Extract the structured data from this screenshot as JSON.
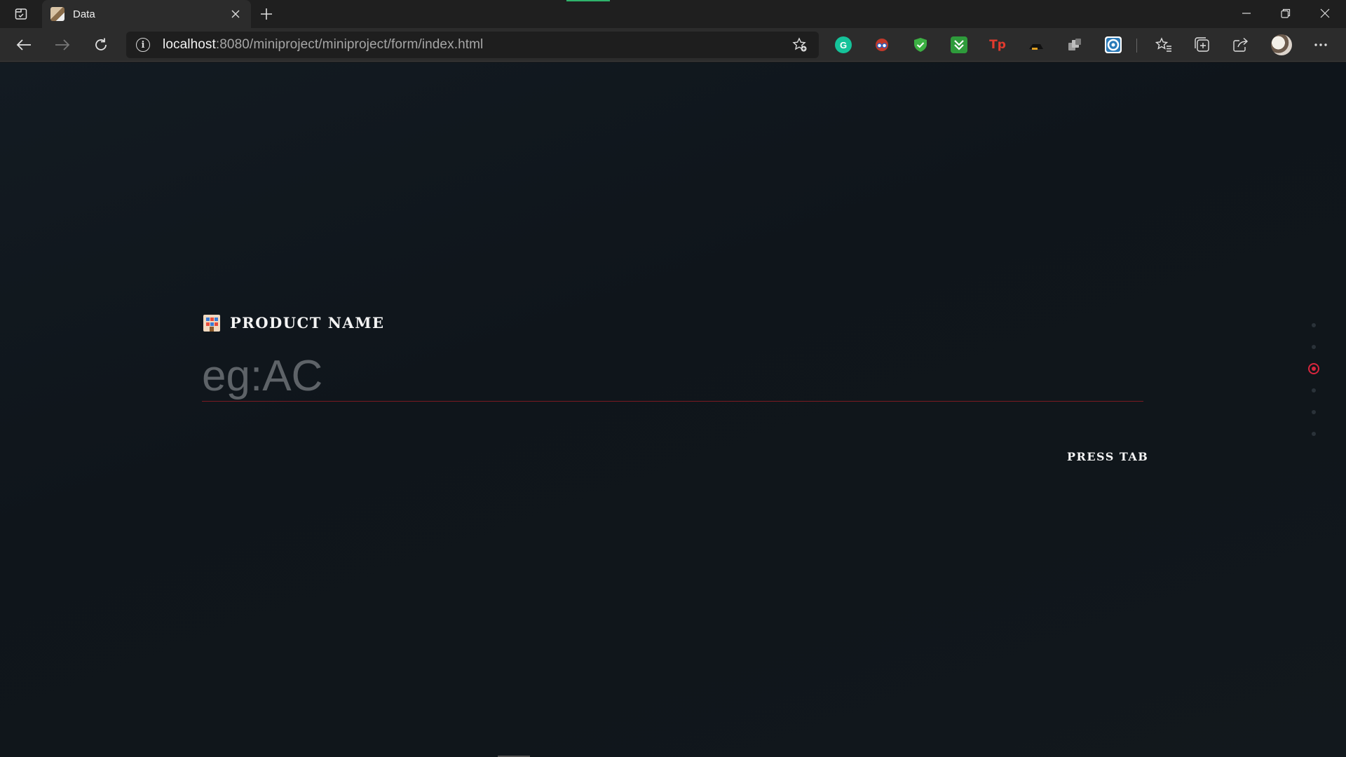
{
  "browser": {
    "tab": {
      "title": "Data"
    },
    "address": {
      "host": "localhost",
      "path": ":8080/miniproject/miniproject/form/index.html"
    },
    "extensions": [
      "grammarly-icon",
      "glasses-extension-icon",
      "shield-check-icon",
      "download-arrow-icon",
      "tp-extension-icon",
      "dark-extension-icon",
      "copy-extension-icon",
      "circle-extension-icon"
    ],
    "ext_labels": {
      "tp": "Tp",
      "grammarly": "G"
    }
  },
  "form": {
    "label": "PRODUCT NAME",
    "placeholder": "eg:AC",
    "value": "",
    "hint": "PRESS TAB",
    "steps_total": 6,
    "current_step": 3
  },
  "colors": {
    "accent": "#d7263d",
    "underline": "#7a1a22",
    "background": "#10161b"
  }
}
